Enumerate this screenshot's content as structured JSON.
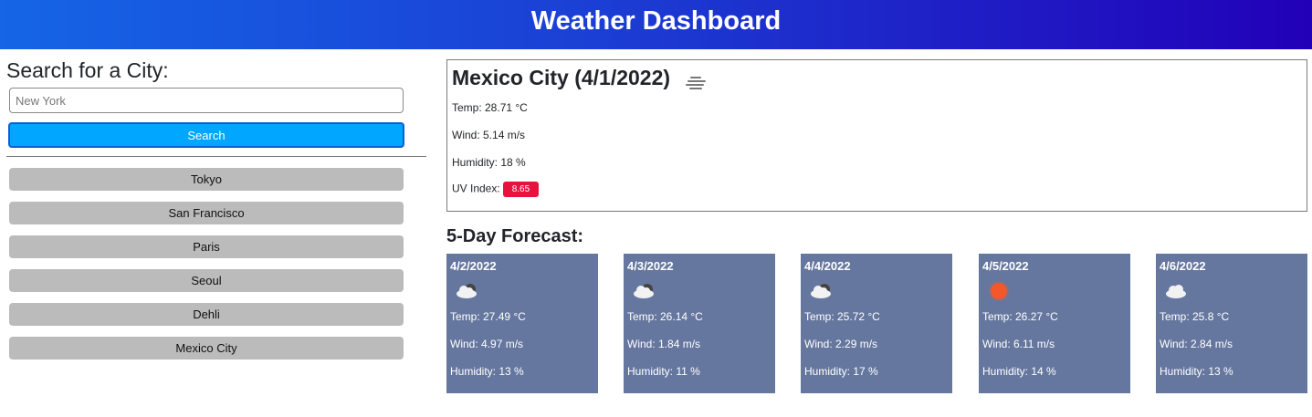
{
  "header": {
    "title": "Weather Dashboard"
  },
  "search": {
    "title": "Search for a City:",
    "placeholder": "New York",
    "button_label": "Search"
  },
  "history": [
    "Tokyo",
    "San Francisco",
    "Paris",
    "Seoul",
    "Dehli",
    "Mexico City"
  ],
  "current": {
    "city": "Mexico City (4/1/2022)",
    "icon": "haze-icon",
    "temp": "Temp: 28.71 °C",
    "wind": "Wind: 5.14 m/s",
    "humidity": "Humidity: 18 %",
    "uv_label": "UV Index:",
    "uv_value": "8.65",
    "uv_color": "#e8123f"
  },
  "forecast": {
    "title": "5-Day Forecast:",
    "days": [
      {
        "date": "4/2/2022",
        "icon": "dark-cloud-icon",
        "temp": "Temp: 27.49 °C",
        "wind": "Wind: 4.97 m/s",
        "humidity": "Humidity: 13 %"
      },
      {
        "date": "4/3/2022",
        "icon": "dark-cloud-icon",
        "temp": "Temp: 26.14 °C",
        "wind": "Wind: 1.84 m/s",
        "humidity": "Humidity: 11 %"
      },
      {
        "date": "4/4/2022",
        "icon": "dark-cloud-icon",
        "temp": "Temp: 25.72 °C",
        "wind": "Wind: 2.29 m/s",
        "humidity": "Humidity: 17 %"
      },
      {
        "date": "4/5/2022",
        "icon": "sun-icon",
        "temp": "Temp: 26.27 °C",
        "wind": "Wind: 6.11 m/s",
        "humidity": "Humidity: 14 %"
      },
      {
        "date": "4/6/2022",
        "icon": "cloud-icon",
        "temp": "Temp: 25.8 °C",
        "wind": "Wind: 2.84 m/s",
        "humidity": "Humidity: 13 %"
      }
    ]
  },
  "colors": {
    "header_gradient_start": "#1565e6",
    "header_gradient_end": "#2200b8",
    "search_button": "#00a6ff",
    "history_button": "#bbbbbb",
    "forecast_card": "#66779f",
    "sun": "#f4582a"
  }
}
